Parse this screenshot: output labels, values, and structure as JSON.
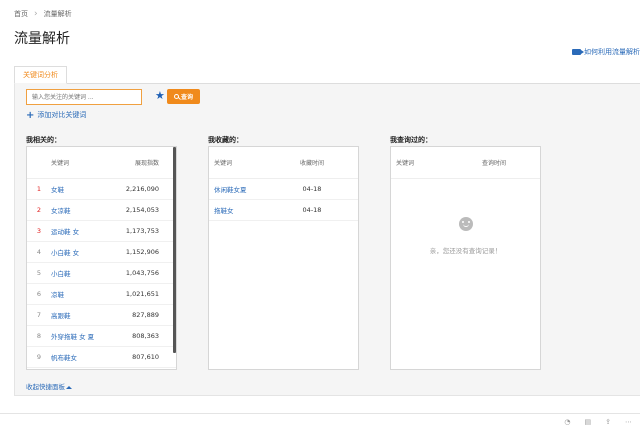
{
  "breadcrumb": {
    "home": "首页",
    "current": "流量解析"
  },
  "page_title": "流量解析",
  "help_link": "如何利用流量解析",
  "tab_label": "关键词分析",
  "search": {
    "placeholder": "输入您关注的关键词 ...",
    "button_label": "查询",
    "add_compare": "添加对比关键词"
  },
  "related": {
    "title": "我相关的：",
    "col_keyword": "关键词",
    "col_index": "展现指数",
    "rows": [
      {
        "rank": "1",
        "keyword": "女鞋",
        "value": "2,216,090"
      },
      {
        "rank": "2",
        "keyword": "女凉鞋",
        "value": "2,154,053"
      },
      {
        "rank": "3",
        "keyword": "运动鞋 女",
        "value": "1,173,753"
      },
      {
        "rank": "4",
        "keyword": "小白鞋 女",
        "value": "1,152,906"
      },
      {
        "rank": "5",
        "keyword": "小白鞋",
        "value": "1,043,756"
      },
      {
        "rank": "6",
        "keyword": "凉鞋",
        "value": "1,021,651"
      },
      {
        "rank": "7",
        "keyword": "高跟鞋",
        "value": "827,889"
      },
      {
        "rank": "8",
        "keyword": "外穿拖鞋 女 夏",
        "value": "808,363"
      },
      {
        "rank": "9",
        "keyword": "帆布鞋女",
        "value": "807,610"
      }
    ]
  },
  "favorites": {
    "title": "我收藏的：",
    "col_keyword": "关键词",
    "col_time": "收藏时间",
    "rows": [
      {
        "keyword": "休闲鞋女夏",
        "time": "04-18"
      },
      {
        "keyword": "拖鞋女",
        "time": "04-18"
      }
    ]
  },
  "queried": {
    "title": "我查询过的：",
    "col_keyword": "关键词",
    "col_time": "查询时间",
    "empty_text": "亲，您还没有查询记录！"
  },
  "collapse_label": "收起快捷面板",
  "colors": {
    "accent": "#f08a1c",
    "link": "#2a6ab8",
    "rank_top": "#e02020"
  }
}
